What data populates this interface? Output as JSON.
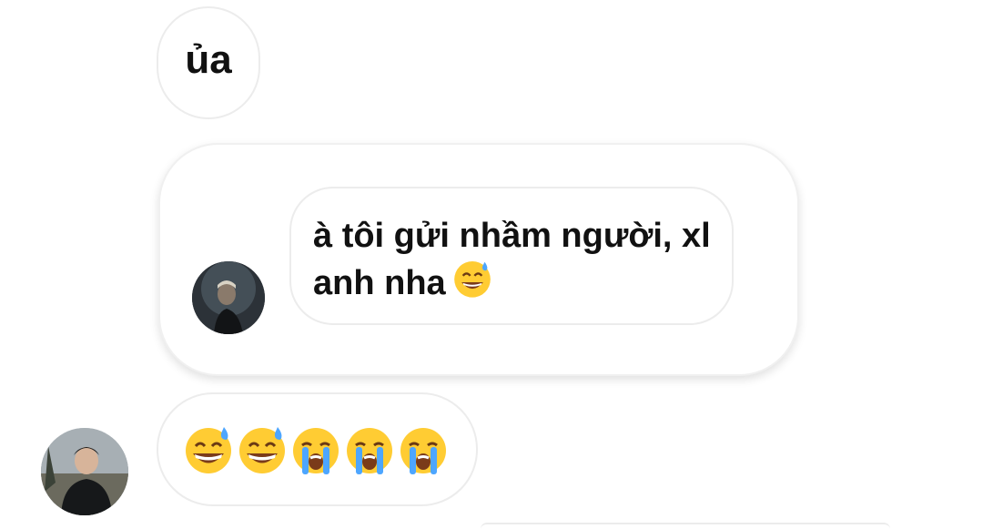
{
  "messages": [
    {
      "text": "ủa"
    },
    {
      "reply_text": "à tôi gửi nhầm người, xl anh nha",
      "reply_emoji": "sweat-smile-emoji"
    },
    {
      "emojis": [
        "sweat-smile-emoji",
        "sweat-smile-emoji",
        "crying-emoji",
        "crying-emoji",
        "crying-emoji"
      ]
    }
  ],
  "colors": {
    "bubble_border": "#ececec",
    "emoji_face": "#ffcc33",
    "emoji_tear": "#4da6ff",
    "background": "#ffffff"
  }
}
